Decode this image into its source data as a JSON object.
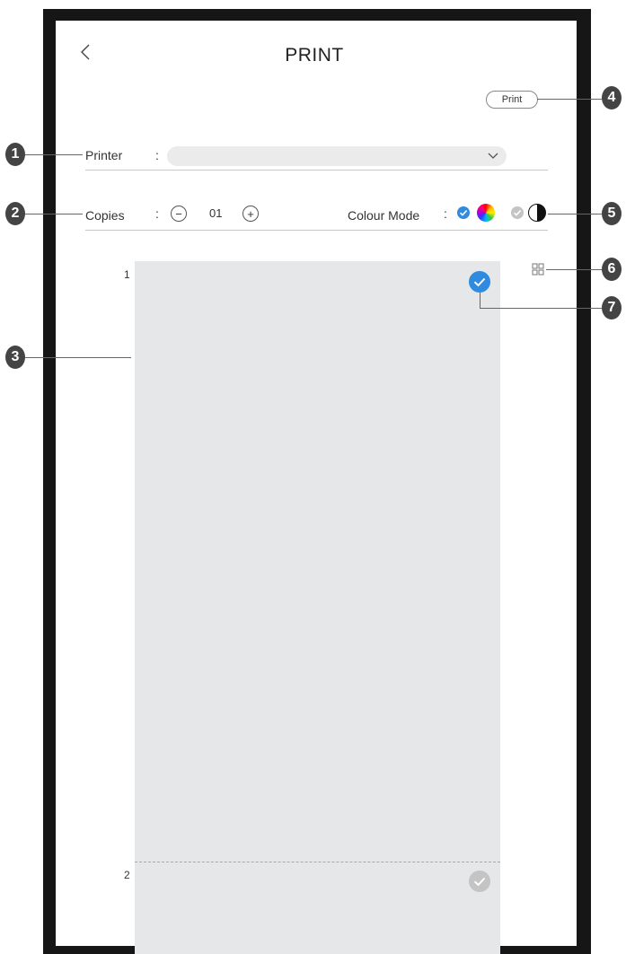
{
  "header": {
    "back_icon": "chevron-left-icon",
    "back_glyph": "‹",
    "title": "PRINT",
    "print_label": "Print"
  },
  "printer": {
    "label": "Printer",
    "colon": ":",
    "value": "",
    "dropdown_glyph": "⌄"
  },
  "copies": {
    "label": "Copies",
    "colon": ":",
    "minus": "−",
    "value": "01",
    "plus": "+"
  },
  "colour_mode": {
    "label": "Colour Mode",
    "colon": ":",
    "options": [
      {
        "name": "colour",
        "selected": true
      },
      {
        "name": "black-and-white",
        "selected": false
      }
    ]
  },
  "pages": [
    {
      "number": "1",
      "selected": true
    },
    {
      "number": "2",
      "selected": false
    }
  ],
  "callouts": [
    "1",
    "2",
    "3",
    "4",
    "5",
    "6",
    "7"
  ],
  "colors": {
    "accent": "#2f8be0",
    "unselected": "#c4c4c4",
    "preview_bg": "#e6e7e9",
    "callout": "#444444"
  }
}
